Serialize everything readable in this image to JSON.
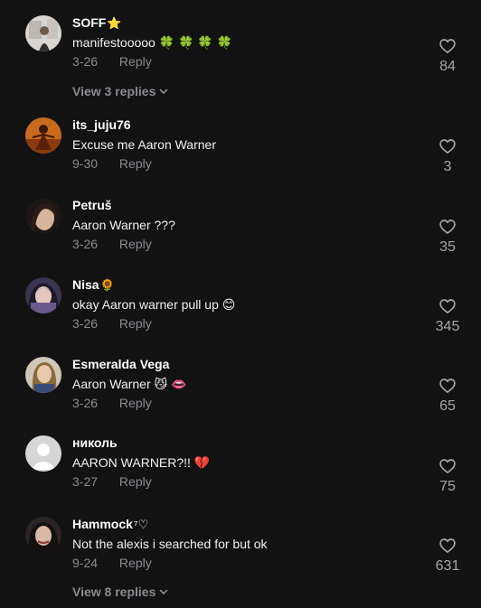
{
  "comments": [
    {
      "username": "SOFF",
      "badge": "⭐",
      "text": "manifestooooo 🍀 🍀 🍀 🍀",
      "date": "3-26",
      "reply_label": "Reply",
      "likes": "84"
    },
    {
      "username": "its_juju76",
      "badge": "",
      "text": "Excuse me Aaron Warner",
      "date": "9-30",
      "reply_label": "Reply",
      "likes": "3"
    },
    {
      "username": "Petruš",
      "badge": "",
      "text": "Aaron Warner ???",
      "date": "3-26",
      "reply_label": "Reply",
      "likes": "35"
    },
    {
      "username": "Nisa",
      "badge": "🌻",
      "text": "okay Aaron warner pull up 😊",
      "date": "3-26",
      "reply_label": "Reply",
      "likes": "345"
    },
    {
      "username": "Esmeralda Vega",
      "badge": "",
      "text": "Aaron Warner 😼 👄",
      "date": "3-26",
      "reply_label": "Reply",
      "likes": "65"
    },
    {
      "username": "николь",
      "badge": "",
      "text": "AARON WARNER?!! 💔",
      "date": "3-27",
      "reply_label": "Reply",
      "likes": "75"
    },
    {
      "username": "Hammock",
      "badge": "⁷♡",
      "text": "Not the alexis i searched for but ok",
      "date": "9-24",
      "reply_label": "Reply",
      "likes": "631"
    }
  ],
  "view_replies": [
    {
      "label": "View 3 replies"
    },
    {
      "label": "View 8 replies"
    }
  ],
  "colors": {
    "background": "#121212",
    "username": "#ffffff",
    "text": "#f1f1f2",
    "meta": "#8a8b91",
    "like_count": "#a6a6ab"
  },
  "icons": {
    "like": "heart-outline-icon",
    "expand": "chevron-down-icon",
    "default_avatar": "person-silhouette-icon"
  }
}
